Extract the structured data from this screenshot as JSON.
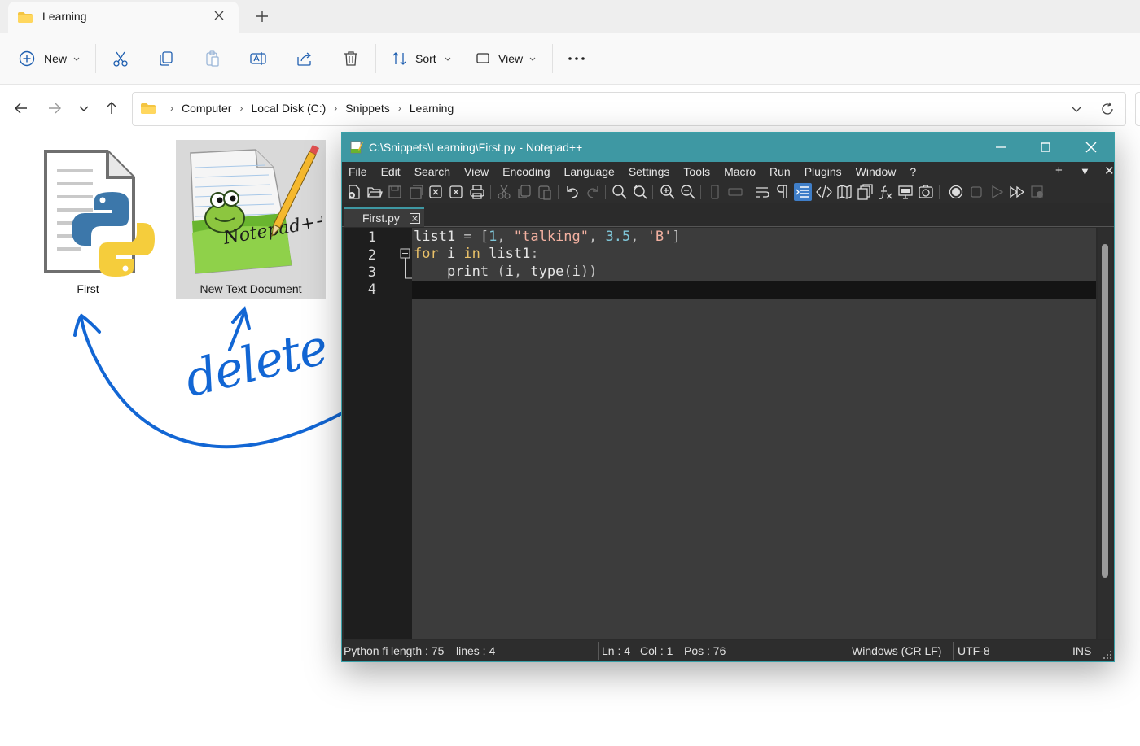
{
  "explorer": {
    "tab_title": "Learning",
    "toolbar": {
      "new_label": "New",
      "sort_label": "Sort",
      "view_label": "View",
      "icons": [
        "cut-icon",
        "copy-icon",
        "paste-icon",
        "rename-icon",
        "share-icon",
        "delete-icon",
        "more-icon"
      ]
    },
    "breadcrumb": [
      "Computer",
      "Local Disk (C:)",
      "Snippets",
      "Learning"
    ],
    "files": [
      {
        "name": "First",
        "icon": "python-file-icon",
        "selected": false
      },
      {
        "name": "New Text Document",
        "icon": "notepadpp-file-icon",
        "selected": true
      }
    ]
  },
  "annotation": {
    "text": "delete",
    "color": "#1266d4"
  },
  "notepadpp": {
    "title": "C:\\Snippets\\Learning\\First.py - Notepad++",
    "menu": [
      "File",
      "Edit",
      "Search",
      "View",
      "Encoding",
      "Language",
      "Settings",
      "Tools",
      "Macro",
      "Run",
      "Plugins",
      "Window",
      "?"
    ],
    "menu_right": [
      "+",
      "▼",
      "✕"
    ],
    "file_tab": "First.py",
    "line_numbers": [
      "1",
      "2",
      "3",
      "4"
    ],
    "code": {
      "l1_var": "list1",
      "l1_eq": " = ",
      "l1_open": "[",
      "l1_n1": "1",
      "l1_c1": ", ",
      "l1_s1": "\"talking\"",
      "l1_c2": ", ",
      "l1_n2": "3.5",
      "l1_c3": ", ",
      "l1_s2": "'B'",
      "l1_close": "]",
      "l2_for": "for",
      "l2_mid": " i ",
      "l2_in": "in",
      "l2_rest": " list1",
      "l2_colon": ":",
      "l3_indent": "    ",
      "l3_print": "print",
      "l3_space": " ",
      "l3_open": "(",
      "l3_args": "i",
      "l3_comma": ", ",
      "l3_type": "type",
      "l3_open2": "(",
      "l3_i": "i",
      "l3_close": "))"
    },
    "status": {
      "lang": "Python fi",
      "length": "length : 75",
      "lines": "lines : 4",
      "ln": "Ln : 4",
      "col": "Col : 1",
      "pos": "Pos : 76",
      "eol": "Windows (CR LF)",
      "enc": "UTF-8",
      "mode": "INS"
    },
    "colors": {
      "titlebar": "#3e98a3",
      "keyword": "#e8c068",
      "number": "#7fc6d8",
      "string": "#f2b0a0"
    }
  }
}
